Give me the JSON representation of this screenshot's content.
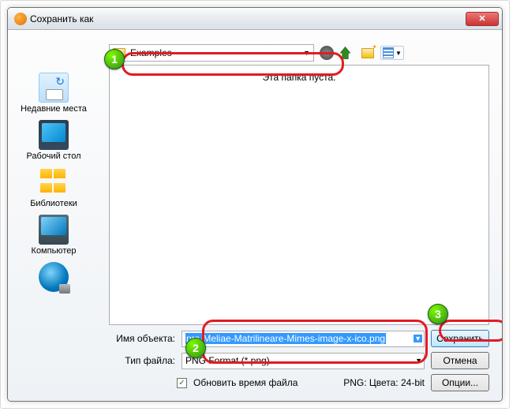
{
  "window": {
    "title": "Сохранить как"
  },
  "folder": {
    "name": "Examples"
  },
  "file_list": {
    "empty_message": "Эта папка пуста."
  },
  "sidebar": {
    "recent": "Недавние места",
    "desktop": "Рабочий стол",
    "libraries": "Библиотеки",
    "computer": "Компьютер",
    "network": ""
  },
  "fields": {
    "filename_label": "Имя объекта:",
    "filename_value": "pra-Meliae-Matrilineare-Mimes-image-x-ico.png",
    "filetype_label": "Тип файла:",
    "filetype_value": "PNG Format (*.png)"
  },
  "buttons": {
    "save": "Сохранить",
    "cancel": "Отмена",
    "options": "Опции..."
  },
  "checkbox": {
    "label": "Обновить время файла",
    "checked": "✓"
  },
  "status": {
    "format": "PNG: Цвета: 24-bit"
  },
  "annotations": {
    "one": "1",
    "two": "2",
    "three": "3"
  }
}
